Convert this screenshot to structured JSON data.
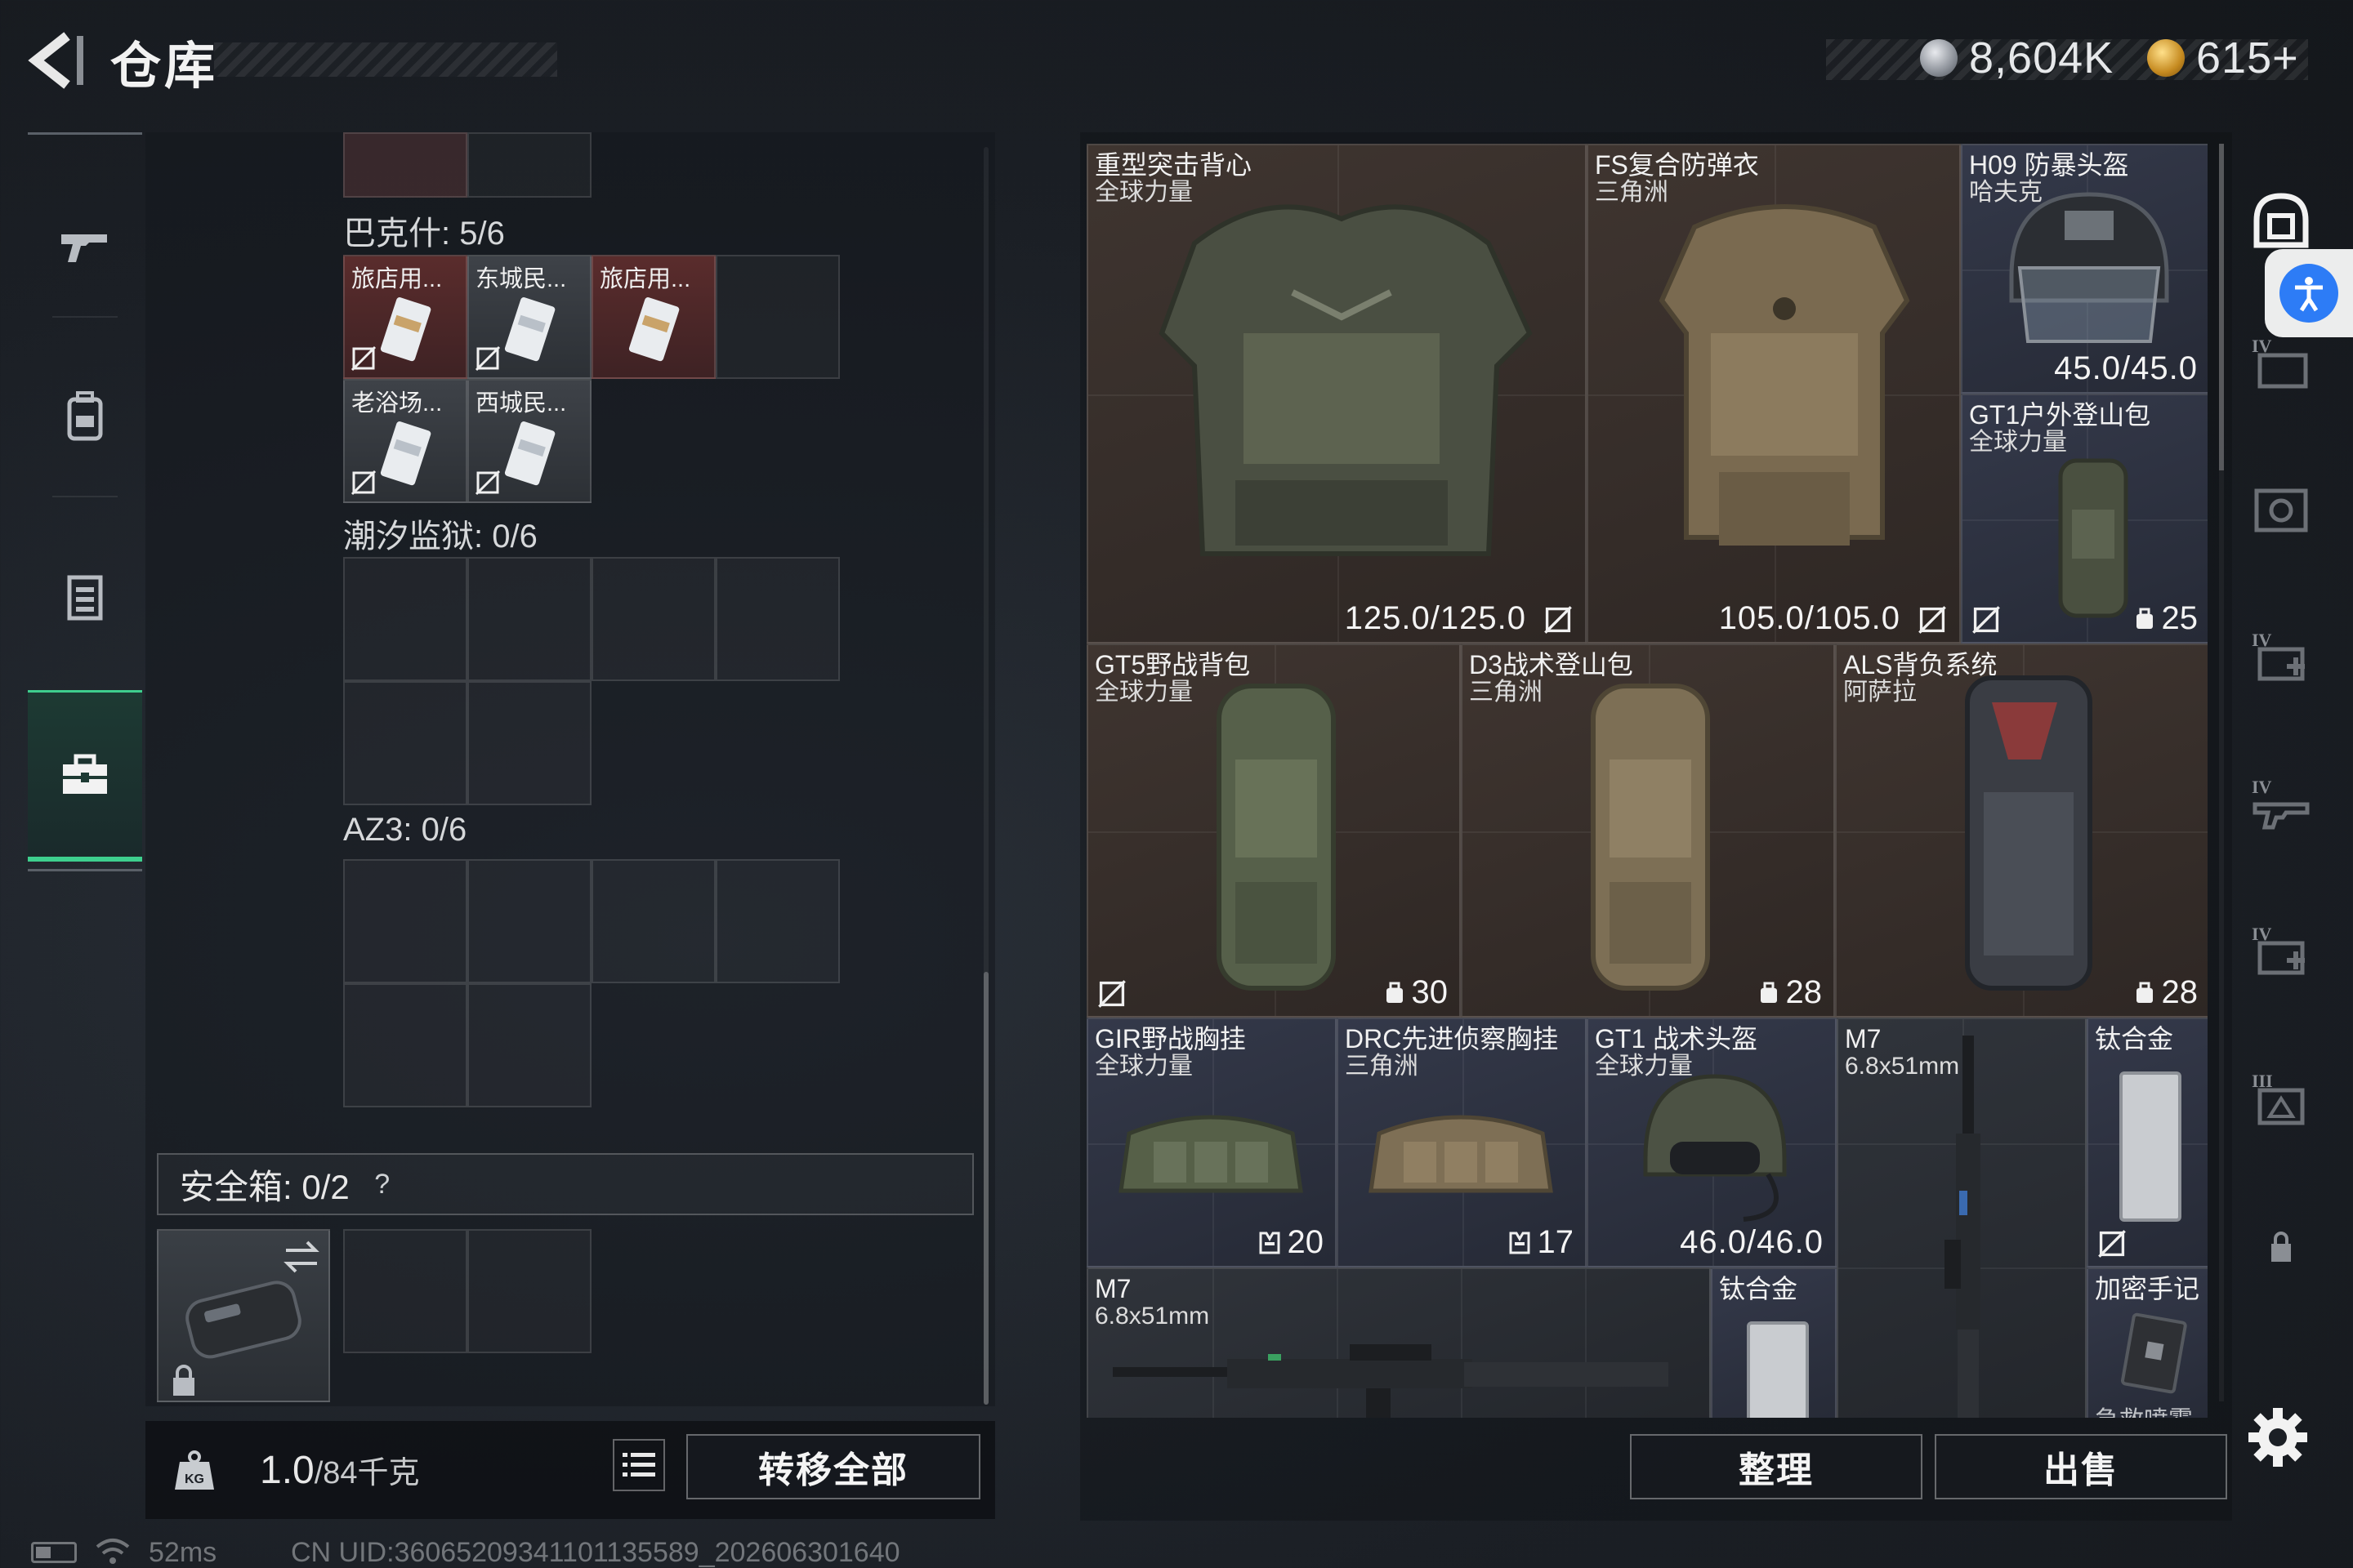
{
  "header": {
    "title": "仓库",
    "currency_silver": "8,604K",
    "currency_gold": "615+"
  },
  "left_nav": {
    "items": [
      "weapons",
      "backpack",
      "armor",
      "toolbox"
    ],
    "active_index": 3
  },
  "storage": {
    "sections": [
      {
        "label": "巴克什: 5/6",
        "keys": [
          {
            "name": "旅店用...",
            "color": "red"
          },
          {
            "name": "东城民...",
            "color": "grey"
          },
          {
            "name": "旅店用...",
            "color": "red"
          },
          {
            "name": "老浴场...",
            "color": "grey"
          },
          {
            "name": "西城民...",
            "color": "grey"
          }
        ]
      },
      {
        "label": "潮汐监狱: 0/6",
        "keys": []
      },
      {
        "label": "AZ3: 0/6",
        "keys": []
      }
    ],
    "safebox_label": "安全箱:  0/2",
    "safebox_help": "?",
    "weight_value": "1.0",
    "weight_unit": "/84千克",
    "transfer_all_label": "转移全部"
  },
  "items": [
    {
      "name": "重型突击背心",
      "sub": "全球力量",
      "value": "125.0/125.0"
    },
    {
      "name": "FS复合防弹衣",
      "sub": "三角洲",
      "value": "105.0/105.0"
    },
    {
      "name": "H09 防暴头盔",
      "sub": "哈夫克",
      "value": "45.0/45.0"
    },
    {
      "name": "GT1户外登山包",
      "sub": "全球力量",
      "value": "25"
    },
    {
      "name": "GT5野战背包",
      "sub": "全球力量",
      "value": "30"
    },
    {
      "name": "D3战术登山包",
      "sub": "三角洲",
      "value": "28"
    },
    {
      "name": "ALS背负系统",
      "sub": "阿萨拉",
      "value": "28"
    },
    {
      "name": "GIR野战胸挂",
      "sub": "全球力量",
      "value": "20"
    },
    {
      "name": "DRC先进侦察胸挂",
      "sub": "三角洲",
      "value": "17"
    },
    {
      "name": "GT1 战术头盔",
      "sub": "全球力量",
      "value": "46.0/46.0"
    },
    {
      "name": "M7",
      "sub": "6.8x51mm",
      "value": ""
    },
    {
      "name": "钛合金",
      "sub": "",
      "value": ""
    },
    {
      "name": "M7",
      "sub": "6.8x51mm",
      "value": ""
    },
    {
      "name": "钛合金",
      "sub": "",
      "value": ""
    },
    {
      "name": "加密手记",
      "sub": "",
      "value": ""
    },
    {
      "name": "急救喷雾",
      "sub": "",
      "value": ""
    }
  ],
  "actions": {
    "sort_label": "整理",
    "sell_label": "出售"
  },
  "status": {
    "ping": "52ms",
    "uid": "CN UID:36065209341101135589_202606301640"
  },
  "right_sidebar": {
    "tiers": [
      "IV",
      "",
      "IV",
      "IV",
      "IV",
      "III"
    ]
  }
}
